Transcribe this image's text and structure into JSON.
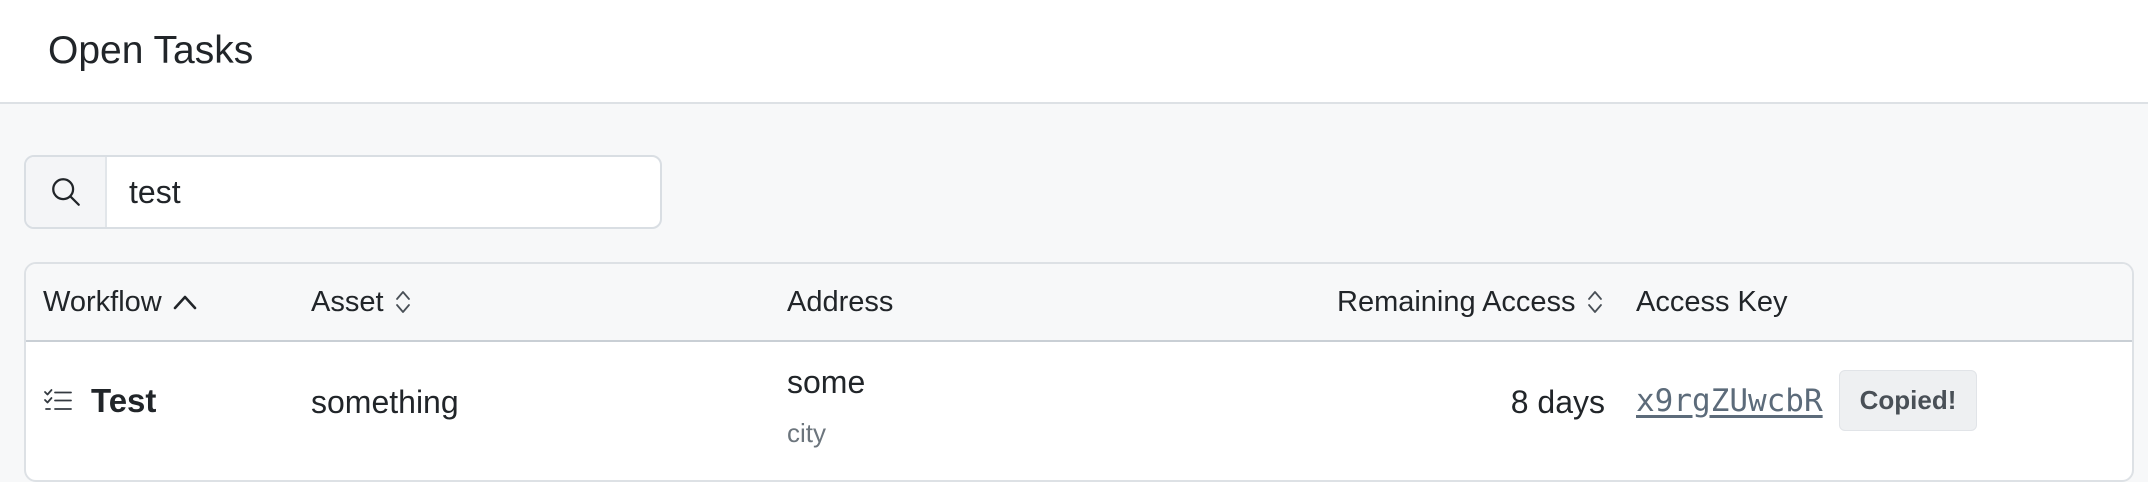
{
  "page": {
    "title": "Open Tasks"
  },
  "search": {
    "value": "test",
    "icon": "search-icon"
  },
  "table": {
    "columns": [
      {
        "label": "Workflow",
        "sort": "ascending",
        "sort_icon": "chevron-up-icon"
      },
      {
        "label": "Asset",
        "sort": "sortable",
        "sort_icon": "sort-icon"
      },
      {
        "label": "Address",
        "sort": "none"
      },
      {
        "label": "Remaining Access",
        "sort": "sortable",
        "sort_icon": "sort-icon"
      },
      {
        "label": "Access Key",
        "sort": "none"
      }
    ],
    "rows": [
      {
        "workflow_icon": "task-list-icon",
        "workflow": "Test",
        "asset": "something",
        "address_line1": "some",
        "address_line2": "city",
        "remaining_access": "8 days",
        "access_key": "x9rgZUwcbR",
        "copy_status": "Copied!"
      }
    ]
  }
}
